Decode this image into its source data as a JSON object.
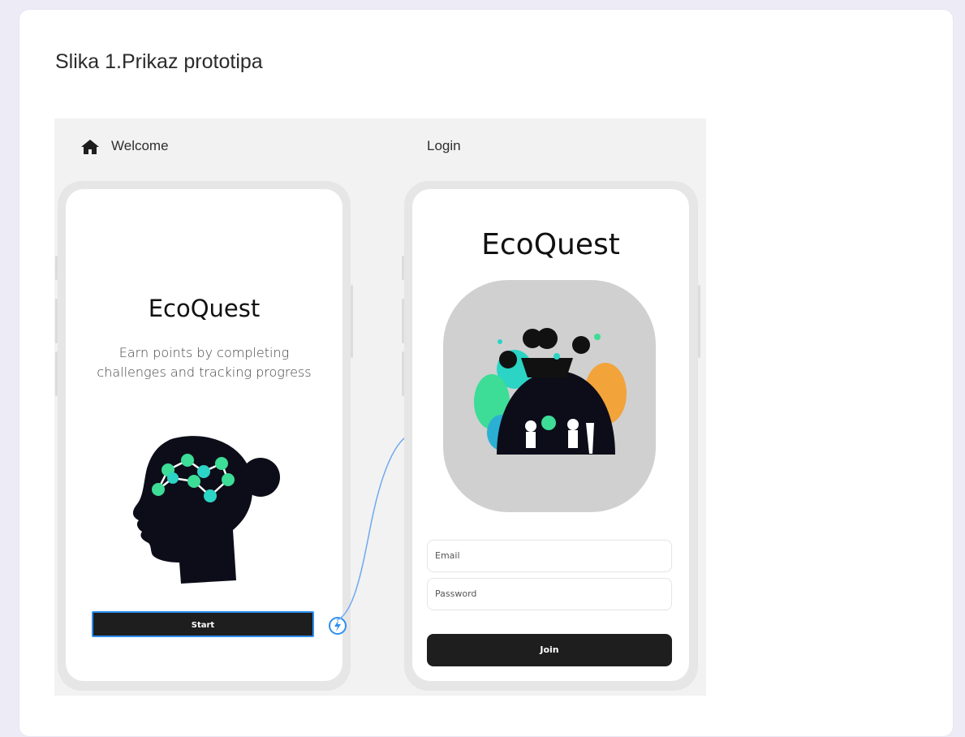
{
  "caption": "Slika 1.Prikaz prototipa",
  "frames": {
    "welcome": {
      "label": "Welcome",
      "app_title": "EcoQuest",
      "subtitle_line1": "Earn points by completing",
      "subtitle_line2": "challenges and tracking progress",
      "start_label": "Start"
    },
    "login": {
      "label": "Login",
      "app_title": "EcoQuest",
      "email_placeholder": "Email",
      "password_placeholder": "Password",
      "join_label": "Join"
    }
  },
  "icons": {
    "home": "home-icon",
    "lightning": "lightning-bolt-icon"
  },
  "colors": {
    "page_bg": "#ecebf6",
    "canvas_bg": "#f2f2f2",
    "button_dark": "#1e1e1e",
    "selection_blue": "#2f8ff0",
    "accent_green": "#3ddc97",
    "accent_teal": "#2bd4c4"
  }
}
